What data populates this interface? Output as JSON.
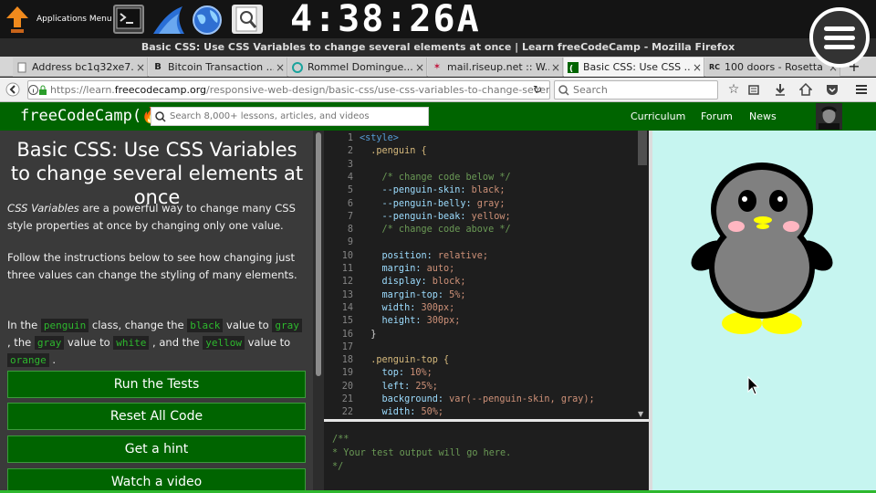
{
  "desktop": {
    "launcher_label": "Applications Menu",
    "clock": "4:38:26A"
  },
  "window": {
    "title": "Basic CSS: Use CSS Variables to change several elements at once | Learn freeCodeCamp - Mozilla Firefox"
  },
  "tabs": [
    {
      "label": "Address bc1q32xe7...",
      "favicon": "page-icon"
    },
    {
      "label": "Bitcoin Transaction ...",
      "favicon": "B"
    },
    {
      "label": "Rommel Domingue...",
      "favicon": "circle"
    },
    {
      "label": "mail.riseup.net :: W...",
      "favicon": "star"
    },
    {
      "label": "Basic CSS: Use CSS ...",
      "favicon": "fcc",
      "active": true
    },
    {
      "label": "100 doors - Rosetta ...",
      "favicon": "rc"
    }
  ],
  "navbar": {
    "url_prefix": "https://learn.",
    "url_host": "freecodecamp.org",
    "url_path": "/responsive-web-design/basic-css/use-css-variables-to-change-several",
    "search_placeholder": "Search"
  },
  "fcc": {
    "logo": "freeCodeCamp(🔥)",
    "search_placeholder": "Search 8,000+ lessons, articles, and videos",
    "nav": [
      "Curriculum",
      "Forum",
      "News"
    ]
  },
  "lesson": {
    "title": "Basic CSS: Use CSS Variables to change several elements at once",
    "intro_em": "CSS Variables",
    "intro_rest": " are a powerful way to change many CSS style properties at once by changing only one value.",
    "para2": "Follow the instructions below to see how changing just three values can change the styling of many elements.",
    "instr": {
      "t1": "In the ",
      "c1": "penguin",
      "t2": " class, change the ",
      "c2": "black",
      "t3": " value to ",
      "c3": "gray",
      "t4": " , the ",
      "c4": "gray",
      "t5": " value to ",
      "c5": "white",
      "t6": " , and the ",
      "c6": "yellow",
      "t7": " value to ",
      "c7": "orange",
      "t8": " ."
    },
    "buttons": [
      "Run the Tests",
      "Reset All Code",
      "Get a hint",
      "Watch a video"
    ]
  },
  "editor": {
    "lines": [
      {
        "n": "1",
        "text": "<style>",
        "kind": "tag"
      },
      {
        "n": "2",
        "text": "  .penguin {",
        "kind": "sel"
      },
      {
        "n": "3",
        "text": "",
        "kind": "pn"
      },
      {
        "n": "4",
        "text": "    /* change code below */",
        "kind": "cm"
      },
      {
        "n": "5",
        "prop": "    --penguin-skin:",
        "val": " black;"
      },
      {
        "n": "6",
        "prop": "    --penguin-belly:",
        "val": " gray;"
      },
      {
        "n": "7",
        "prop": "    --penguin-beak:",
        "val": " yellow;"
      },
      {
        "n": "8",
        "text": "    /* change code above */",
        "kind": "cm"
      },
      {
        "n": "9",
        "text": "",
        "kind": "pn"
      },
      {
        "n": "10",
        "prop": "    position:",
        "val": " relative;"
      },
      {
        "n": "11",
        "prop": "    margin:",
        "val": " auto;"
      },
      {
        "n": "12",
        "prop": "    display:",
        "val": " block;"
      },
      {
        "n": "13",
        "prop": "    margin-top:",
        "val": " 5%;"
      },
      {
        "n": "14",
        "prop": "    width:",
        "val": " 300px;"
      },
      {
        "n": "15",
        "prop": "    height:",
        "val": " 300px;"
      },
      {
        "n": "16",
        "text": "  }",
        "kind": "pn"
      },
      {
        "n": "17",
        "text": "",
        "kind": "pn"
      },
      {
        "n": "18",
        "text": "  .penguin-top {",
        "kind": "sel"
      },
      {
        "n": "19",
        "prop": "    top:",
        "val": " 10%;"
      },
      {
        "n": "20",
        "prop": "    left:",
        "val": " 25%;"
      },
      {
        "n": "21",
        "prop": "    background:",
        "val": " var(--penguin-skin, gray);"
      },
      {
        "n": "22",
        "prop": "    width:",
        "val": " 50%;"
      }
    ],
    "output": "/**\n* Your test output will go here.\n*/"
  },
  "colors": {
    "fcc_green": "#006400",
    "preview_bg": "#c6f5f0",
    "penguin_skin": "#000000",
    "penguin_belly": "#808080",
    "penguin_beak": "#ffff00"
  }
}
